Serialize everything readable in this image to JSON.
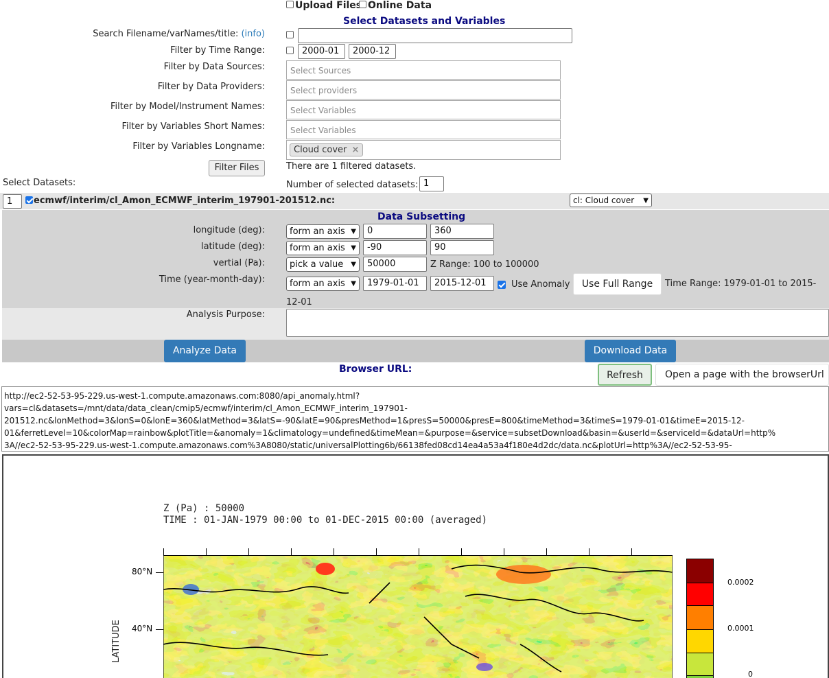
{
  "top": {
    "upload_files": "Upload Files",
    "online_data": "Online Data"
  },
  "section_title": "Select Datasets and Variables",
  "filters": {
    "search_label": "Search Filename/varNames/title:",
    "info_link": "(info)",
    "search_value": "",
    "time_range_label": "Filter by Time Range:",
    "time_start": "2000-01",
    "time_end": "2000-12",
    "sources_label": "Filter by Data Sources:",
    "sources_placeholder": "Select Sources",
    "providers_label": "Filter by Data Providers:",
    "providers_placeholder": "Select providers",
    "model_label": "Filter by Model/Instrument Names:",
    "model_placeholder": "Select Variables",
    "shortnames_label": "Filter by Variables Short Names:",
    "shortnames_placeholder": "Select Variables",
    "longname_label": "Filter by Variables Longname:",
    "longname_tag": "Cloud cover",
    "filter_button": "Filter Files",
    "filtered_status": "There are 1 filtered datasets."
  },
  "datasets": {
    "select_label": "Select Datasets:",
    "num_selected_label": "Number of selected datasets:",
    "num_selected_value": "1",
    "row_index": "1",
    "dataset_name": "ecmwf/interim/cl_Amon_ECMWF_interim_197901-201512.nc:",
    "variable_select": "cl: Cloud cover"
  },
  "subsetting": {
    "title": "Data Subsetting",
    "lon_label": "longitude (deg):",
    "lon_method": "form an axis",
    "lon_start": "0",
    "lon_end": "360",
    "lat_label": "latitude (deg):",
    "lat_method": "form an axis",
    "lat_start": "-90",
    "lat_end": "90",
    "vert_label": "vertial (Pa):",
    "vert_method": "pick a value",
    "vert_value": "50000",
    "z_range": "Z Range: 100 to 100000",
    "time_label": "Time (year-month-day):",
    "time_method": "form an axis",
    "time_start": "1979-01-01",
    "time_end": "2015-12-01",
    "use_anomaly": "Use Anomaly",
    "use_full_range": "Use Full Range",
    "time_range_a": "Time Range: 1979-01-01 to 2015-",
    "time_range_b": "12-01",
    "purpose_label": "Analysis Purpose:",
    "purpose_value": ""
  },
  "actions": {
    "analyze": "Analyze Data",
    "download": "Download Data"
  },
  "browser": {
    "label": "Browser URL:",
    "refresh": "Refresh",
    "open_page": "Open a page with the browserUrl",
    "url_line1": "http://ec2-52-53-95-229.us-west-1.compute.amazonaws.com:8080/api_anomaly.html?",
    "url_line2": "vars=cl&datasets=/mnt/data/data_clean/cmip5/ecmwf/interim/cl_Amon_ECMWF_interim_197901-",
    "url_line3": "201512.nc&lonMethod=3&lonS=0&lonE=360&latMethod=3&latS=-90&latE=90&presMethod=1&presS=50000&presE=800&timeMethod=3&timeS=1979-01-01&timeE=2015-12-",
    "url_line4": "01&ferretLevel=10&colorMap=rainbow&plotTitle=&anomaly=1&climatology=undefined&timeMean=&purpose=&service=subsetDownload&basin=&userId=&serviceId=&dataUrl=http%",
    "url_line5": "3A//ec2-52-53-95-229.us-west-1.compute.amazonaws.com%3A8080/static/universalPlotting6b/66138fed08cd14ea4a53a4f180e4d2dc/data.nc&plotUrl=http%3A//ec2-52-53-95-"
  },
  "plot": {
    "header1": "Z (Pa) : 50000",
    "header2": "TIME : 01-JAN-1979 00:00 to 01-DEC-2015 00:00 (averaged)",
    "lat_ticks": [
      "80°N",
      "40°N"
    ],
    "axis_label": "LATITUDE",
    "colorbar_labels": [
      "0.0002",
      "0.0001",
      "0"
    ],
    "colorbar_colors": [
      "#8b0000",
      "#ff0000",
      "#ff7f00",
      "#ffd700",
      "#c8e63c",
      "#7fd43c"
    ]
  }
}
